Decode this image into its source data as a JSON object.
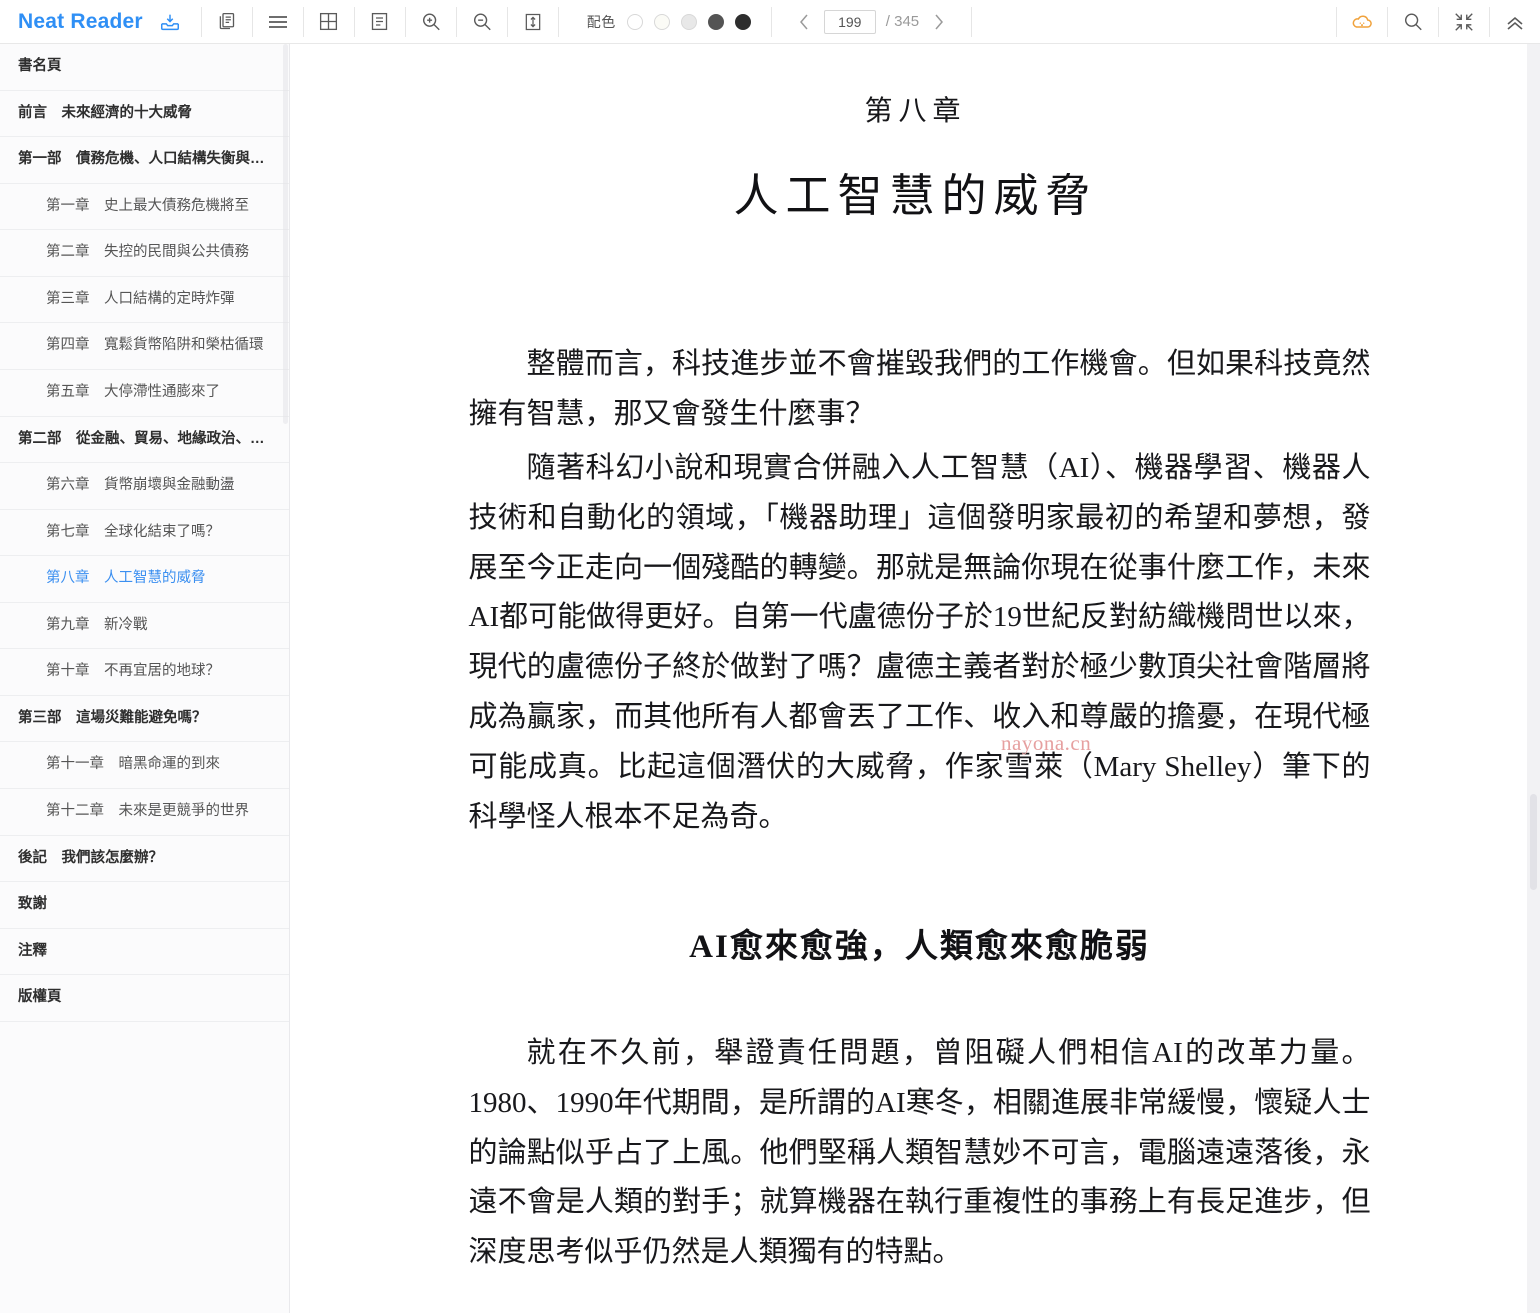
{
  "app": {
    "brand": "Neat Reader",
    "brand_color": "#2f8ff5"
  },
  "toolbar": {
    "icons": [
      {
        "name": "save-to-shelf-icon",
        "glyph": "save-tray"
      },
      {
        "name": "copy-icon",
        "glyph": "copy"
      },
      {
        "name": "menu-icon",
        "glyph": "hamburger"
      },
      {
        "name": "grid-layout-icon",
        "glyph": "grid"
      },
      {
        "name": "notes-icon",
        "glyph": "note-lines"
      },
      {
        "name": "zoom-in-icon",
        "glyph": "magnifier-plus"
      },
      {
        "name": "zoom-out-icon",
        "glyph": "magnifier-minus"
      },
      {
        "name": "line-height-icon",
        "glyph": "vertical-arrows-box"
      }
    ],
    "color_scheme": {
      "label": "配色",
      "swatches": [
        "#ffffff",
        "#fbfbf6",
        "#e8e8e8",
        "#545454",
        "#2e2e2e"
      ],
      "selected_index": 0
    },
    "pager": {
      "prev_label": "‹",
      "next_label": "›",
      "current_page": "199",
      "total_label": "/ 345"
    },
    "right_icons": [
      {
        "name": "cloud-sync-icon",
        "glyph": "cloud",
        "color": "#f0a23c"
      },
      {
        "name": "search-icon",
        "glyph": "magnifier"
      },
      {
        "name": "fullscreen-exit-icon",
        "glyph": "compress"
      },
      {
        "name": "collapse-toolbar-icon",
        "glyph": "double-chevron-up"
      }
    ]
  },
  "sidebar": {
    "toc": [
      {
        "label": "書名頁",
        "level": 0,
        "active": false
      },
      {
        "label": "前言　未來經濟的十大威脅",
        "level": 0,
        "active": false
      },
      {
        "label": "第一部　債務危機、人口結構失衡與政…",
        "level": 0,
        "active": false
      },
      {
        "label": "第一章　史上最大債務危機將至",
        "level": 1,
        "active": false
      },
      {
        "label": "第二章　失控的民間與公共債務",
        "level": 1,
        "active": false
      },
      {
        "label": "第三章　人口結構的定時炸彈",
        "level": 1,
        "active": false
      },
      {
        "label": "第四章　寬鬆貨幣陷阱和榮枯循環",
        "level": 1,
        "active": false
      },
      {
        "label": "第五章　大停滯性通膨來了",
        "level": 1,
        "active": false
      },
      {
        "label": "第二部　從金融、貿易、地緣政治、科…",
        "level": 0,
        "active": false
      },
      {
        "label": "第六章　貨幣崩壞與金融動盪",
        "level": 1,
        "active": false
      },
      {
        "label": "第七章　全球化結束了嗎？",
        "level": 1,
        "active": false
      },
      {
        "label": "第八章　人工智慧的威脅",
        "level": 1,
        "active": true
      },
      {
        "label": "第九章　新冷戰",
        "level": 1,
        "active": false
      },
      {
        "label": "第十章　不再宜居的地球？",
        "level": 1,
        "active": false
      },
      {
        "label": "第三部　這場災難能避免嗎？",
        "level": 0,
        "active": false
      },
      {
        "label": "第十一章　暗黑命運的到來",
        "level": 1,
        "active": false
      },
      {
        "label": "第十二章　未來是更競爭的世界",
        "level": 1,
        "active": false
      },
      {
        "label": "後記　我們該怎麼辦？",
        "level": 0,
        "active": false
      },
      {
        "label": "致謝",
        "level": 0,
        "active": false
      },
      {
        "label": "注釋",
        "level": 0,
        "active": false
      },
      {
        "label": "版權頁",
        "level": 0,
        "active": false
      }
    ],
    "active_color": "#3b8ff0"
  },
  "content": {
    "chapter_number": "第八章",
    "chapter_title": "人工智慧的威脅",
    "paragraph_1": "整體而言，科技進步並不會摧毀我們的工作機會。但如果科技竟然擁有智慧，那又會發生什麼事？",
    "paragraph_2": "隨著科幻小說和現實合併融入人工智慧（AI）、機器學習、機器人技術和自動化的領域，「機器助理」這個發明家最初的希望和夢想，發展至今正走向一個殘酷的轉變。那就是無論你現在從事什麼工作，未來AI都可能做得更好。自第一代盧德份子於19世紀反對紡織機問世以來，現代的盧德份子終於做對了嗎？盧德主義者對於極少數頂尖社會階層將成為贏家，而其他所有人都會丟了工作、收入和尊嚴的擔憂，在現代極可能成真。比起這個潛伏的大威脅，作家雪萊（Mary Shelley）筆下的科學怪人根本不足為奇。",
    "section_heading": "AI愈來愈強，人類愈來愈脆弱",
    "paragraph_3": "就在不久前，舉證責任問題，曾阻礙人們相信AI的改革力量。1980、1990年代期間，是所謂的AI寒冬，相關進展非常緩慢，懷疑人士的論點似乎占了上風。他們堅稱人類智慧妙不可言，電腦遠遠落後，永遠不會是人類的對手；就算機器在執行重複性的事務上有長足進步，但深度思考似乎仍然是人類獨有的特點。",
    "watermark": "nayona.cn"
  }
}
